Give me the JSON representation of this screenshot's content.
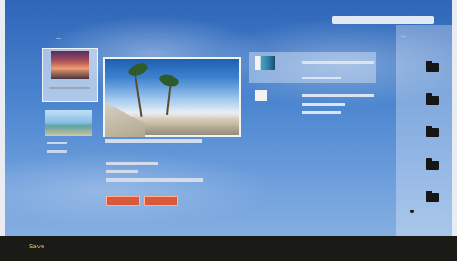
{
  "search": {
    "placeholder": ""
  },
  "album": {
    "title": "—"
  },
  "main_photo": {
    "caption": ""
  },
  "details": {
    "line1": "",
    "line2": "",
    "line3": ""
  },
  "actions": {
    "button1_label": "",
    "button2_label": ""
  },
  "right_panel": {
    "header": "—"
  },
  "footer": {
    "label": "Save"
  },
  "colors": {
    "accent": "#d85a3a",
    "footer_text": "#e6c35a",
    "sky": "#4c86d0"
  }
}
